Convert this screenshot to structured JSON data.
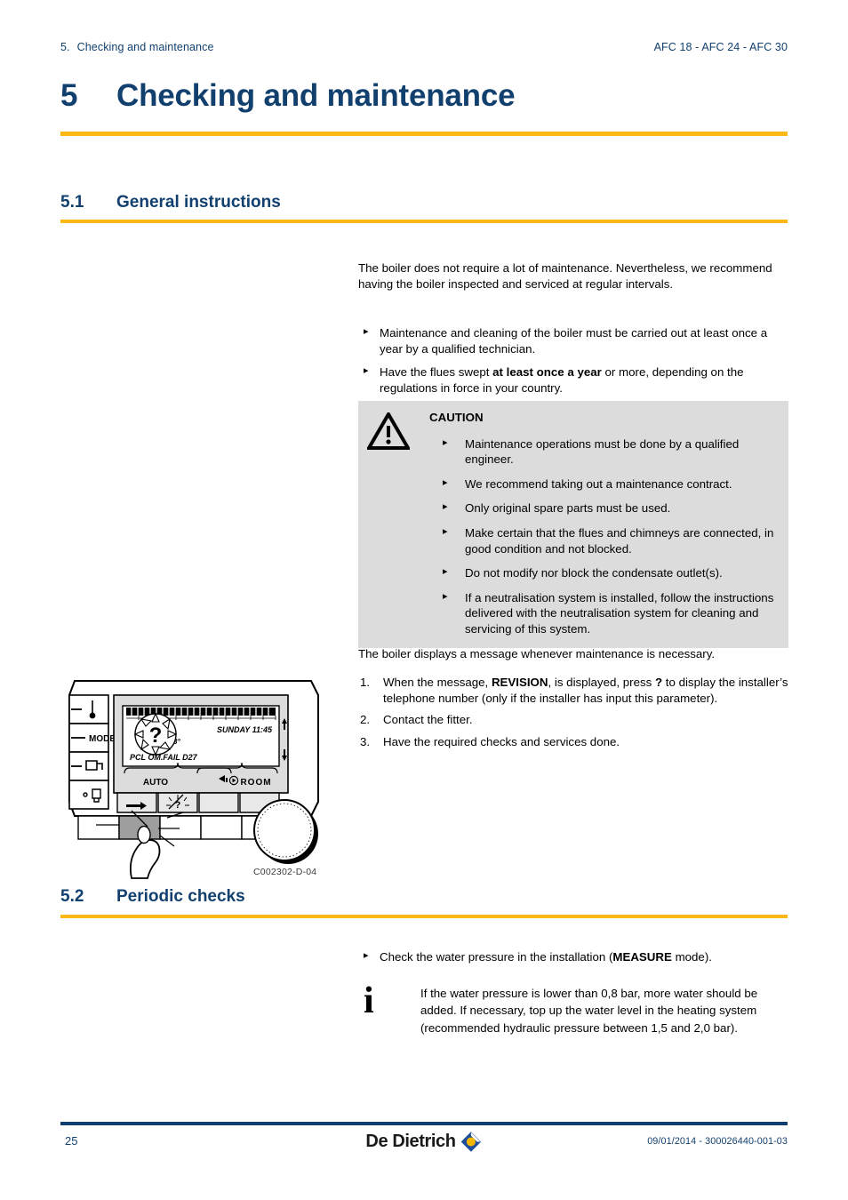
{
  "header": {
    "section_number": "5.",
    "section_title": "Checking and maintenance",
    "product_line": "AFC 18 - AFC 24 - AFC 30"
  },
  "chapter": {
    "number": "5",
    "title": "Checking and maintenance"
  },
  "sections": {
    "general": {
      "number": "5.1",
      "title": "General instructions",
      "intro": "The boiler does not require a lot of maintenance. Nevertheless, we recommend having the boiler inspected and serviced at regular intervals.",
      "bullets": [
        "Maintenance and cleaning of the boiler must be carried out at least once a year by a qualified technician.",
        "Have the flues swept at least once a year or more, depending on the regulations in force in your country."
      ],
      "bullet2_bold": "at least once a year",
      "after_caution": "The boiler displays a message whenever maintenance is necessary.",
      "steps": [
        "When the message, REVISION, is displayed, press ? to display the installer’s telephone number (only if the installer has input this parameter).",
        "Contact the fitter.",
        "Have the required checks and services done."
      ],
      "step1_bold_a": "REVISION",
      "step1_bold_b": "?"
    },
    "periodic": {
      "number": "5.2",
      "title": "Periodic checks",
      "bullet": "Check the water pressure in the installation (MEASURE mode).",
      "bullet_bold": "MEASURE",
      "note": "If the water pressure is lower than 0,8 bar, more water should be added. If necessary, top up the water level in the heating system (recommended hydraulic pressure between 1,5 and 2,0 bar)."
    }
  },
  "caution": {
    "title": "CAUTION",
    "items": [
      "Maintenance operations must be done by a qualified engineer.",
      "We recommend taking out a maintenance contract.",
      "Only original spare parts must be used.",
      "Make certain that the flues and chimneys are connected, in good condition and not blocked.",
      "Do not modify nor block the condensate outlet(s).",
      "If a neutralisation system is installed, follow the instructions delivered with the neutralisation system for cleaning and servicing of this system."
    ]
  },
  "figure": {
    "caption": "C002302-D-04",
    "display": {
      "day_time": "SUNDAY 11:45",
      "temperature": "68°",
      "message": "PCL OM.FAIL D27",
      "question_mark": "?",
      "mode_label": "AUTO",
      "room_label": "ROOM"
    },
    "panel_buttons": [
      "MODE"
    ]
  },
  "footer": {
    "page": "25",
    "brand": "De Dietrich",
    "doc_ref": "09/01/2014 - 300026440-001-03"
  },
  "colors": {
    "heading_blue": "#11406f",
    "rule_gold": "#fcb814",
    "caution_bg": "#dcdcdc",
    "logo_blue": "#1f4e9c",
    "logo_yellow": "#f5b800"
  }
}
